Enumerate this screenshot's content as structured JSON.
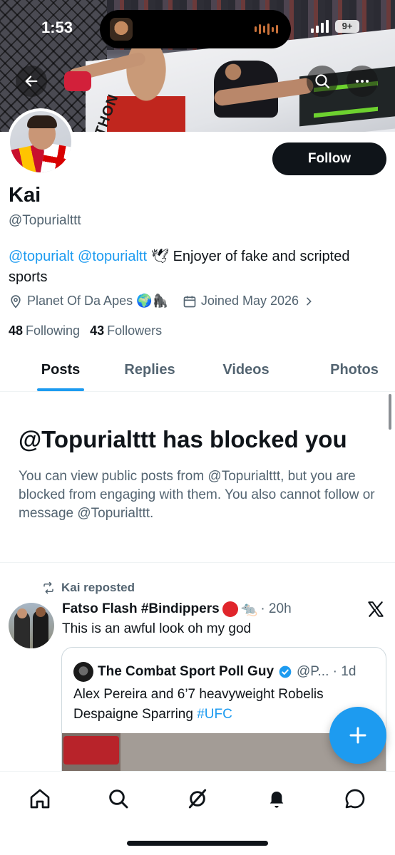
{
  "status_bar": {
    "time": "1:53",
    "battery": "9+"
  },
  "banner": {
    "mat_text": "THON"
  },
  "profile": {
    "follow_label": "Follow",
    "name": "Kai",
    "handle": "@Topurialttt",
    "bio": {
      "mention1": "@topurialt",
      "mention2": "@topurialtt",
      "dove": "🕊",
      "text": "Enjoyer of fake and scripted sports"
    },
    "location": "Planet Of Da Apes 🌍🦍",
    "joined": "Joined May 2026",
    "following_count": "48",
    "following_label": "Following",
    "followers_count": "43",
    "followers_label": "Followers"
  },
  "tabs": [
    {
      "label": "Posts",
      "active": true
    },
    {
      "label": "Replies",
      "active": false
    },
    {
      "label": "Videos",
      "active": false
    },
    {
      "label": "Photos",
      "active": false
    }
  ],
  "blocked": {
    "title": "@Topurialttt has blocked you",
    "description": "You can view public posts from @Topurialttt, but you are blocked from engaging with them. You also cannot follow or message @Topurialttt."
  },
  "tweet": {
    "repost_label": "Kai reposted",
    "author": "Fatso Flash #Bindippers",
    "rat": "🐀",
    "time": "· 20h",
    "text": "This is an awful look oh my god",
    "quote": {
      "author": "The Combat Sport Poll Guy",
      "meta": "@P... · 1d",
      "text": "Alex Pereira and 6’7 heavyweight Robelis Despaigne Sparring ",
      "hashtag": "#UFC"
    }
  },
  "icons": {
    "back": "arrow-left-icon",
    "search": "search-icon",
    "more": "more-icon",
    "location": "location-pin-icon",
    "calendar": "calendar-icon",
    "repost": "repost-icon",
    "verified": "verified-badge-icon",
    "x": "x-logo-icon",
    "compose": "plus-icon",
    "nav": [
      "home-icon",
      "search-icon",
      "grok-icon",
      "notifications-icon",
      "messages-icon"
    ]
  },
  "colors": {
    "accent": "#1d9bf0",
    "text": "#0f1419",
    "muted": "#536471",
    "button": "#0f1419"
  }
}
